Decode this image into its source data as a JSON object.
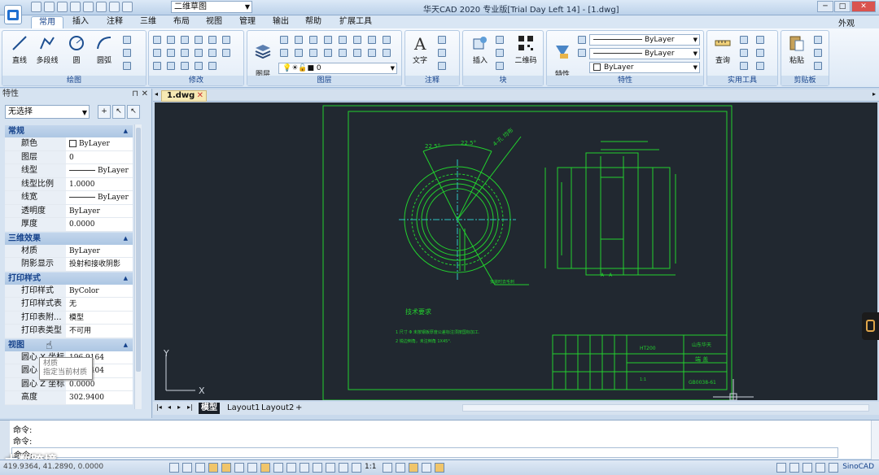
{
  "titlebar": {
    "workspace": "二维草图",
    "title": "华天CAD 2020 专业版[Trial Day Left 14] - [1.dwg]",
    "min": "─",
    "max": "□",
    "close": "✕"
  },
  "tabs": [
    "常用",
    "插入",
    "注释",
    "三维",
    "布局",
    "视图",
    "管理",
    "输出",
    "帮助",
    "扩展工具"
  ],
  "appearance": "外观",
  "ribbon": {
    "draw": {
      "label": "绘图",
      "buttons": [
        "直线",
        "多段线",
        "圆",
        "圆弧"
      ]
    },
    "modify": {
      "label": "修改"
    },
    "layer": {
      "label": "图层",
      "button": "图层\n特性",
      "current_layer": "0"
    },
    "annotate": {
      "label": "注释",
      "button": "文字"
    },
    "block": {
      "label": "块",
      "buttons": [
        "插入",
        "二维码"
      ]
    },
    "properties": {
      "label": "特性",
      "button": "特性\n匹配",
      "color": "ByLayer",
      "linetype": "ByLayer",
      "lineweight": "ByLayer"
    },
    "utilities": {
      "label": "实用工具",
      "button": "查询"
    },
    "clipboard": {
      "label": "剪贴板",
      "button": "粘贴"
    }
  },
  "props": {
    "title": "特性",
    "pin": "⊓",
    "close": "✕",
    "selection": "无选择",
    "sections": [
      {
        "name": "常规",
        "rows": [
          [
            "颜色",
            "ByLayer"
          ],
          [
            "图层",
            "0"
          ],
          [
            "线型",
            "ByLayer"
          ],
          [
            "线型比例",
            "1.0000"
          ],
          [
            "线宽",
            "ByLayer"
          ],
          [
            "透明度",
            "ByLayer"
          ],
          [
            "厚度",
            "0.0000"
          ]
        ]
      },
      {
        "name": "三维效果",
        "rows": [
          [
            "材质",
            "ByLayer"
          ],
          [
            "阴影显示",
            "投射和接收阴影"
          ]
        ]
      },
      {
        "name": "打印样式",
        "rows": [
          [
            "打印样式",
            "ByColor"
          ],
          [
            "打印样式表",
            "无"
          ],
          [
            "打印表附...",
            "模型"
          ],
          [
            "打印表类型",
            "不可用"
          ]
        ]
      },
      {
        "name": "视图",
        "rows": [
          [
            "圆心 X 坐标",
            "196.9164"
          ],
          [
            "圆心 Y 坐标",
            "143.9404"
          ],
          [
            "圆心 Z 坐标",
            "0.0000"
          ],
          [
            "高度",
            "302.9400"
          ]
        ]
      }
    ],
    "tooltip": {
      "title": "材质",
      "desc": "指定当前材质"
    }
  },
  "doctab": {
    "name": "1.dwg",
    "close": "✕"
  },
  "drawing": {
    "tech_title": "技术要求",
    "tech_line1": "1  尺寸 Φ    未按钢板厚度公差标注须按国标加工.",
    "tech_line2": "2  锐边倒角，未注倒角 1X45°.",
    "section_label": "A—A",
    "company": "山东华天",
    "part": "端 盖",
    "drawing_no": "GB0038-61",
    "scale_text": "1:1",
    "material": "HT200",
    "dim_angle1": "22.5°",
    "dim_angle2": "22.5°",
    "dim_note": "4-孔 均布",
    "annot": "安装时去毛刺",
    "ucs_x": "X",
    "ucs_y": "Y"
  },
  "layouts": [
    "模型",
    "Layout1",
    "Layout2",
    "+"
  ],
  "cmd": {
    "lines": [
      "命令:",
      "命令:",
      "命令:"
    ]
  },
  "status": {
    "coords": "419.9364, 41.2890, 0.0000",
    "scale": "1:1",
    "brand": "SinoCAD"
  },
  "watermark": "大数跨境",
  "colors": {
    "canvas": "#212830",
    "drawing": "#22d12e",
    "accent": "#15428b"
  }
}
